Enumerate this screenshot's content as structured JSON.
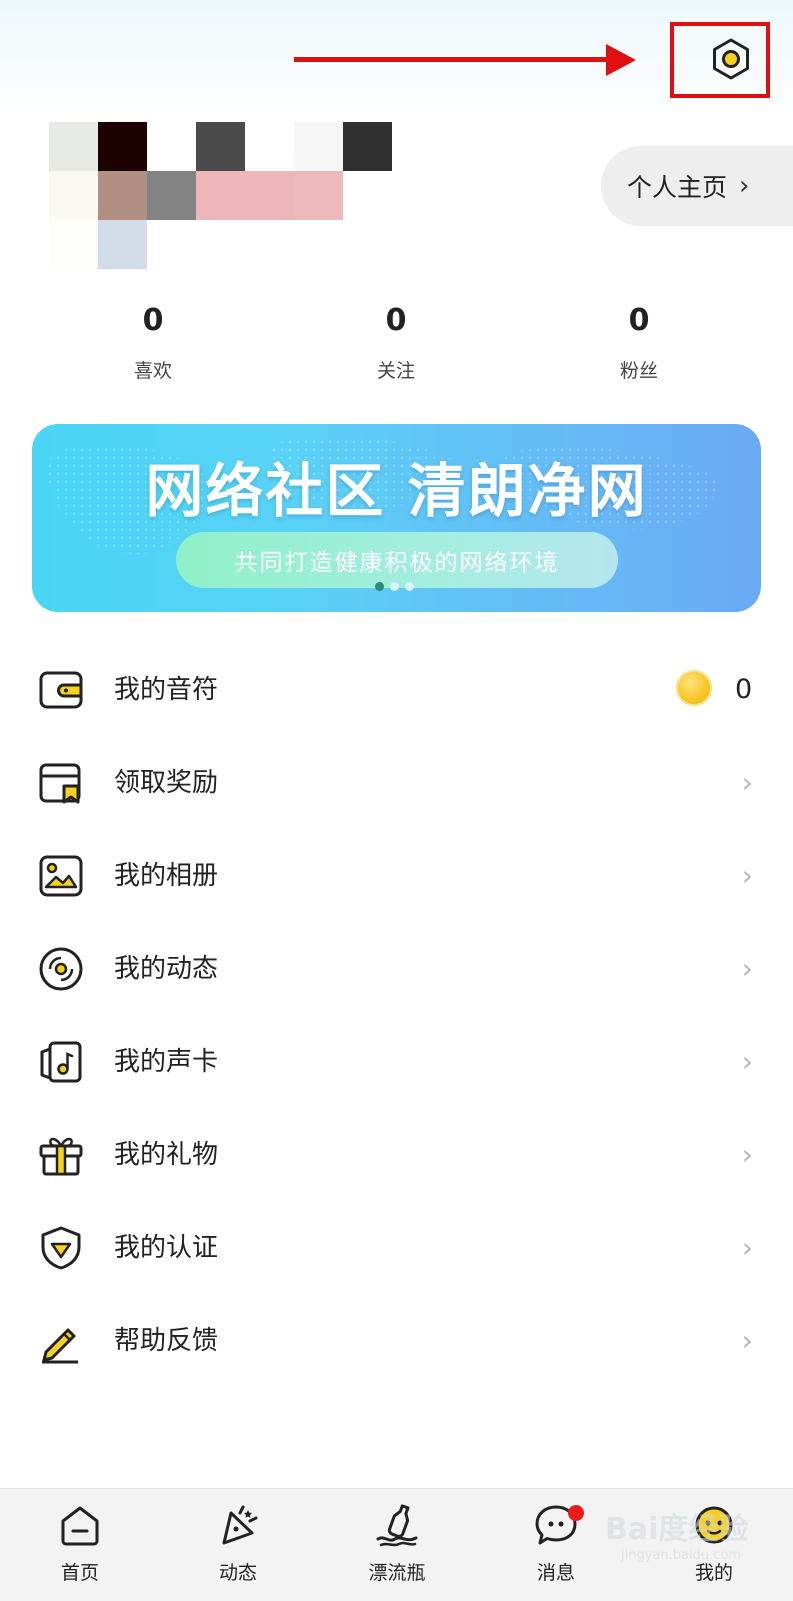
{
  "profile": {
    "homepage_button_label": "个人主页",
    "chevron": "›"
  },
  "stats": [
    {
      "count": "0",
      "label": "喜欢"
    },
    {
      "count": "0",
      "label": "关注"
    },
    {
      "count": "0",
      "label": "粉丝"
    }
  ],
  "banner": {
    "title": "网络社区 清朗净网",
    "subtitle": "共同打造健康积极的网络环境",
    "slide_count": 3,
    "active_slide": 1
  },
  "menu": {
    "items": [
      {
        "label": "我的音符",
        "icon": "wallet-icon",
        "value": "0"
      },
      {
        "label": "领取奖励",
        "icon": "reward-card-icon"
      },
      {
        "label": "我的相册",
        "icon": "photo-album-icon"
      },
      {
        "label": "我的动态",
        "icon": "vinyl-disc-icon"
      },
      {
        "label": "我的声卡",
        "icon": "music-card-icon"
      },
      {
        "label": "我的礼物",
        "icon": "gift-icon"
      },
      {
        "label": "我的认证",
        "icon": "shield-check-icon"
      },
      {
        "label": "帮助反馈",
        "icon": "pencil-icon"
      }
    ],
    "chevron": "›"
  },
  "tabbar": {
    "tabs": [
      {
        "label": "首页",
        "icon": "home-icon"
      },
      {
        "label": "动态",
        "icon": "party-popper-icon"
      },
      {
        "label": "漂流瓶",
        "icon": "drift-bottle-icon"
      },
      {
        "label": "消息",
        "icon": "chat-bubble-icon"
      },
      {
        "label": "我的",
        "icon": "face-icon"
      }
    ]
  },
  "watermark": {
    "brand": "Bai度经验",
    "url": "jingyan.baidu.com"
  },
  "colors": {
    "accent_yellow": "#f6d21e",
    "annotation_red": "#e01010",
    "badge_red": "#ee1a1a"
  }
}
